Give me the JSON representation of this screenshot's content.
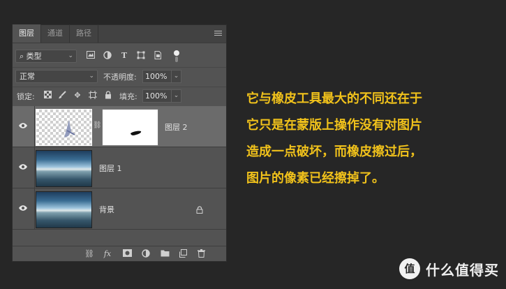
{
  "panel": {
    "tabs": [
      "图层",
      "通道",
      "路径"
    ],
    "filter": {
      "label": "类型"
    },
    "blend_mode": "正常",
    "opacity": {
      "label": "不透明度:",
      "value": "100%"
    },
    "lock": {
      "label": "锁定:"
    },
    "fill": {
      "label": "填充:",
      "value": "100%"
    },
    "layers": [
      {
        "name": "图层 2",
        "selected": true
      },
      {
        "name": "图层 1",
        "selected": false
      },
      {
        "name": "背景",
        "selected": false
      }
    ],
    "footer_fx": "fx"
  },
  "caption": {
    "lines": [
      "它与橡皮工具最大的不同还在于",
      "它只是在蒙版上操作没有对图片",
      "造成一点破坏，而橡皮擦过后，",
      "图片的像素已经擦掉了。"
    ]
  },
  "watermark": {
    "logo": "值",
    "text": "什么值得买"
  },
  "colors": {
    "background": "#262626",
    "caption": "#f1c21b",
    "panel": "#535353",
    "selected_layer": "#6b6b6b"
  }
}
